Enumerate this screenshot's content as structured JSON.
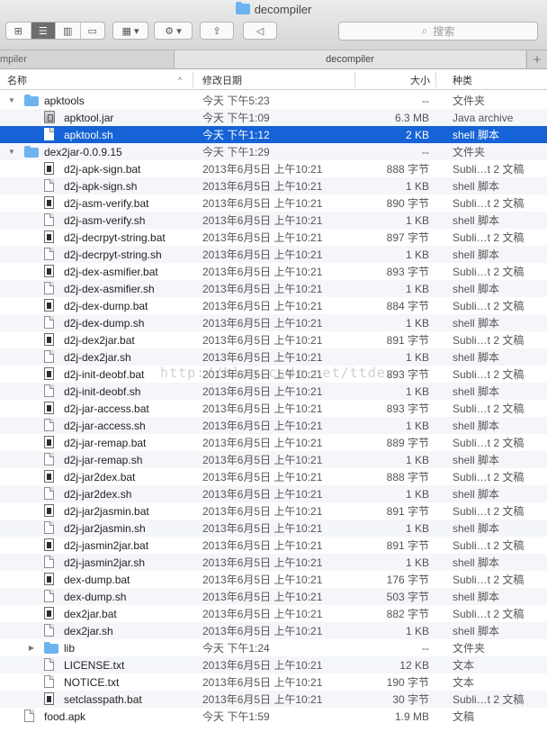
{
  "window": {
    "title": "decompiler"
  },
  "toolbar": {
    "search_placeholder": "搜索",
    "search_icon": "magnifier-icon",
    "view_buttons": [
      "icon-view",
      "list-view",
      "column-view",
      "coverflow-view"
    ],
    "arrange_icon": "grid-icon",
    "action_icon": "gear-icon",
    "share_icon": "share-icon",
    "tag_icon": "tag-icon"
  },
  "tabs": {
    "left_label": "mpiler",
    "active_label": "decompiler",
    "plus": "+"
  },
  "header": {
    "name": "名称",
    "date": "修改日期",
    "size": "大小",
    "kind": "种类"
  },
  "watermark": "http://blog.csdn.net/ttdev",
  "colors": {
    "selection": "#1563d6",
    "folder": "#6cb3f0"
  },
  "rows": [
    {
      "indent": 0,
      "disclosure": "open",
      "icon": "folder",
      "name": "apktools",
      "date": "今天 下午5:23",
      "size": "--",
      "kind": "文件夹"
    },
    {
      "indent": 1,
      "disclosure": "",
      "icon": "jar",
      "name": "apktool.jar",
      "date": "今天 下午1:09",
      "size": "6.3 MB",
      "kind": "Java archive"
    },
    {
      "indent": 1,
      "disclosure": "",
      "icon": "doc",
      "name": "apktool.sh",
      "date": "今天 下午1:12",
      "size": "2 KB",
      "kind": "shell 脚本",
      "selected": true
    },
    {
      "indent": 0,
      "disclosure": "open",
      "icon": "folder",
      "name": "dex2jar-0.0.9.15",
      "date": "今天 下午1:29",
      "size": "--",
      "kind": "文件夹"
    },
    {
      "indent": 1,
      "icon": "exec",
      "name": "d2j-apk-sign.bat",
      "date": "2013年6月5日 上午10:21",
      "size": "888 字节",
      "kind": "Subli…t 2 文稿"
    },
    {
      "indent": 1,
      "icon": "doc",
      "name": "d2j-apk-sign.sh",
      "date": "2013年6月5日 上午10:21",
      "size": "1 KB",
      "kind": "shell 脚本"
    },
    {
      "indent": 1,
      "icon": "exec",
      "name": "d2j-asm-verify.bat",
      "date": "2013年6月5日 上午10:21",
      "size": "890 字节",
      "kind": "Subli…t 2 文稿"
    },
    {
      "indent": 1,
      "icon": "doc",
      "name": "d2j-asm-verify.sh",
      "date": "2013年6月5日 上午10:21",
      "size": "1 KB",
      "kind": "shell 脚本"
    },
    {
      "indent": 1,
      "icon": "exec",
      "name": "d2j-decrpyt-string.bat",
      "date": "2013年6月5日 上午10:21",
      "size": "897 字节",
      "kind": "Subli…t 2 文稿"
    },
    {
      "indent": 1,
      "icon": "doc",
      "name": "d2j-decrpyt-string.sh",
      "date": "2013年6月5日 上午10:21",
      "size": "1 KB",
      "kind": "shell 脚本"
    },
    {
      "indent": 1,
      "icon": "exec",
      "name": "d2j-dex-asmifier.bat",
      "date": "2013年6月5日 上午10:21",
      "size": "893 字节",
      "kind": "Subli…t 2 文稿"
    },
    {
      "indent": 1,
      "icon": "doc",
      "name": "d2j-dex-asmifier.sh",
      "date": "2013年6月5日 上午10:21",
      "size": "1 KB",
      "kind": "shell 脚本"
    },
    {
      "indent": 1,
      "icon": "exec",
      "name": "d2j-dex-dump.bat",
      "date": "2013年6月5日 上午10:21",
      "size": "884 字节",
      "kind": "Subli…t 2 文稿"
    },
    {
      "indent": 1,
      "icon": "doc",
      "name": "d2j-dex-dump.sh",
      "date": "2013年6月5日 上午10:21",
      "size": "1 KB",
      "kind": "shell 脚本"
    },
    {
      "indent": 1,
      "icon": "exec",
      "name": "d2j-dex2jar.bat",
      "date": "2013年6月5日 上午10:21",
      "size": "891 字节",
      "kind": "Subli…t 2 文稿"
    },
    {
      "indent": 1,
      "icon": "doc",
      "name": "d2j-dex2jar.sh",
      "date": "2013年6月5日 上午10:21",
      "size": "1 KB",
      "kind": "shell 脚本"
    },
    {
      "indent": 1,
      "icon": "exec",
      "name": "d2j-init-deobf.bat",
      "date": "2013年6月5日 上午10:21",
      "size": "893 字节",
      "kind": "Subli…t 2 文稿"
    },
    {
      "indent": 1,
      "icon": "doc",
      "name": "d2j-init-deobf.sh",
      "date": "2013年6月5日 上午10:21",
      "size": "1 KB",
      "kind": "shell 脚本"
    },
    {
      "indent": 1,
      "icon": "exec",
      "name": "d2j-jar-access.bat",
      "date": "2013年6月5日 上午10:21",
      "size": "893 字节",
      "kind": "Subli…t 2 文稿"
    },
    {
      "indent": 1,
      "icon": "doc",
      "name": "d2j-jar-access.sh",
      "date": "2013年6月5日 上午10:21",
      "size": "1 KB",
      "kind": "shell 脚本"
    },
    {
      "indent": 1,
      "icon": "exec",
      "name": "d2j-jar-remap.bat",
      "date": "2013年6月5日 上午10:21",
      "size": "889 字节",
      "kind": "Subli…t 2 文稿"
    },
    {
      "indent": 1,
      "icon": "doc",
      "name": "d2j-jar-remap.sh",
      "date": "2013年6月5日 上午10:21",
      "size": "1 KB",
      "kind": "shell 脚本"
    },
    {
      "indent": 1,
      "icon": "exec",
      "name": "d2j-jar2dex.bat",
      "date": "2013年6月5日 上午10:21",
      "size": "888 字节",
      "kind": "Subli…t 2 文稿"
    },
    {
      "indent": 1,
      "icon": "doc",
      "name": "d2j-jar2dex.sh",
      "date": "2013年6月5日 上午10:21",
      "size": "1 KB",
      "kind": "shell 脚本"
    },
    {
      "indent": 1,
      "icon": "exec",
      "name": "d2j-jar2jasmin.bat",
      "date": "2013年6月5日 上午10:21",
      "size": "891 字节",
      "kind": "Subli…t 2 文稿"
    },
    {
      "indent": 1,
      "icon": "doc",
      "name": "d2j-jar2jasmin.sh",
      "date": "2013年6月5日 上午10:21",
      "size": "1 KB",
      "kind": "shell 脚本"
    },
    {
      "indent": 1,
      "icon": "exec",
      "name": "d2j-jasmin2jar.bat",
      "date": "2013年6月5日 上午10:21",
      "size": "891 字节",
      "kind": "Subli…t 2 文稿"
    },
    {
      "indent": 1,
      "icon": "doc",
      "name": "d2j-jasmin2jar.sh",
      "date": "2013年6月5日 上午10:21",
      "size": "1 KB",
      "kind": "shell 脚本"
    },
    {
      "indent": 1,
      "icon": "exec",
      "name": "dex-dump.bat",
      "date": "2013年6月5日 上午10:21",
      "size": "176 字节",
      "kind": "Subli…t 2 文稿"
    },
    {
      "indent": 1,
      "icon": "doc",
      "name": "dex-dump.sh",
      "date": "2013年6月5日 上午10:21",
      "size": "503 字节",
      "kind": "shell 脚本"
    },
    {
      "indent": 1,
      "icon": "exec",
      "name": "dex2jar.bat",
      "date": "2013年6月5日 上午10:21",
      "size": "882 字节",
      "kind": "Subli…t 2 文稿"
    },
    {
      "indent": 1,
      "icon": "doc",
      "name": "dex2jar.sh",
      "date": "2013年6月5日 上午10:21",
      "size": "1 KB",
      "kind": "shell 脚本"
    },
    {
      "indent": 1,
      "disclosure": "closed",
      "icon": "folder",
      "name": "lib",
      "date": "今天 下午1:24",
      "size": "--",
      "kind": "文件夹"
    },
    {
      "indent": 1,
      "icon": "doc",
      "name": "LICENSE.txt",
      "date": "2013年6月5日 上午10:21",
      "size": "12 KB",
      "kind": "文本"
    },
    {
      "indent": 1,
      "icon": "doc",
      "name": "NOTICE.txt",
      "date": "2013年6月5日 上午10:21",
      "size": "190 字节",
      "kind": "文本"
    },
    {
      "indent": 1,
      "icon": "exec",
      "name": "setclasspath.bat",
      "date": "2013年6月5日 上午10:21",
      "size": "30 字节",
      "kind": "Subli…t 2 文稿"
    },
    {
      "indent": 0,
      "icon": "doc",
      "name": "food.apk",
      "date": "今天 下午1:59",
      "size": "1.9 MB",
      "kind": "文稿"
    }
  ]
}
